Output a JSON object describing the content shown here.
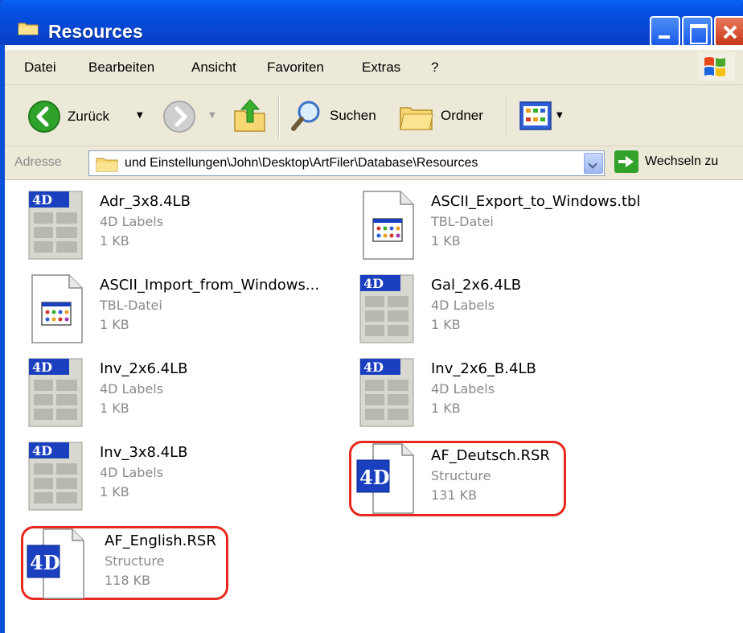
{
  "window": {
    "title": "Resources"
  },
  "menu": [
    "Datei",
    "Bearbeiten",
    "Ansicht",
    "Favoriten",
    "Extras",
    "?"
  ],
  "toolbar": {
    "back_label": "Zurück",
    "search_label": "Suchen",
    "folders_label": "Ordner"
  },
  "address": {
    "label": "Adresse",
    "path": "und Einstellungen\\John\\Desktop\\ArtFiler\\Database\\Resources",
    "go_label": "Wechseln zu"
  },
  "files": [
    {
      "name": "Adr_3x8.4LB",
      "type": "4D Labels",
      "size": "1 KB",
      "icon": "4d-labels-icon"
    },
    {
      "name": "ASCII_Export_to_Windows.tbl",
      "type": "TBL-Datei",
      "size": "1 KB",
      "icon": "tbl-file-icon"
    },
    {
      "name": "ASCII_Import_from_Windows...",
      "type": "TBL-Datei",
      "size": "1 KB",
      "icon": "tbl-file-icon"
    },
    {
      "name": "Gal_2x6.4LB",
      "type": "4D Labels",
      "size": "1 KB",
      "icon": "4d-labels-icon"
    },
    {
      "name": "Inv_2x6.4LB",
      "type": "4D Labels",
      "size": "1 KB",
      "icon": "4d-labels-icon"
    },
    {
      "name": "Inv_2x6_B.4LB",
      "type": "4D Labels",
      "size": "1 KB",
      "icon": "4d-labels-icon"
    },
    {
      "name": "Inv_3x8.4LB",
      "type": "4D Labels",
      "size": "1 KB",
      "icon": "4d-labels-icon"
    },
    {
      "name": "AF_Deutsch.RSR",
      "type": "Structure",
      "size": "131 KB",
      "icon": "4d-structure-icon"
    },
    {
      "name": "AF_English.RSR",
      "type": "Structure",
      "size": "118 KB",
      "icon": "4d-structure-icon"
    }
  ],
  "colors": {
    "titlebar": "#0a4fd8",
    "highlight": "#e8271e",
    "chrome": "#ece9d8"
  }
}
